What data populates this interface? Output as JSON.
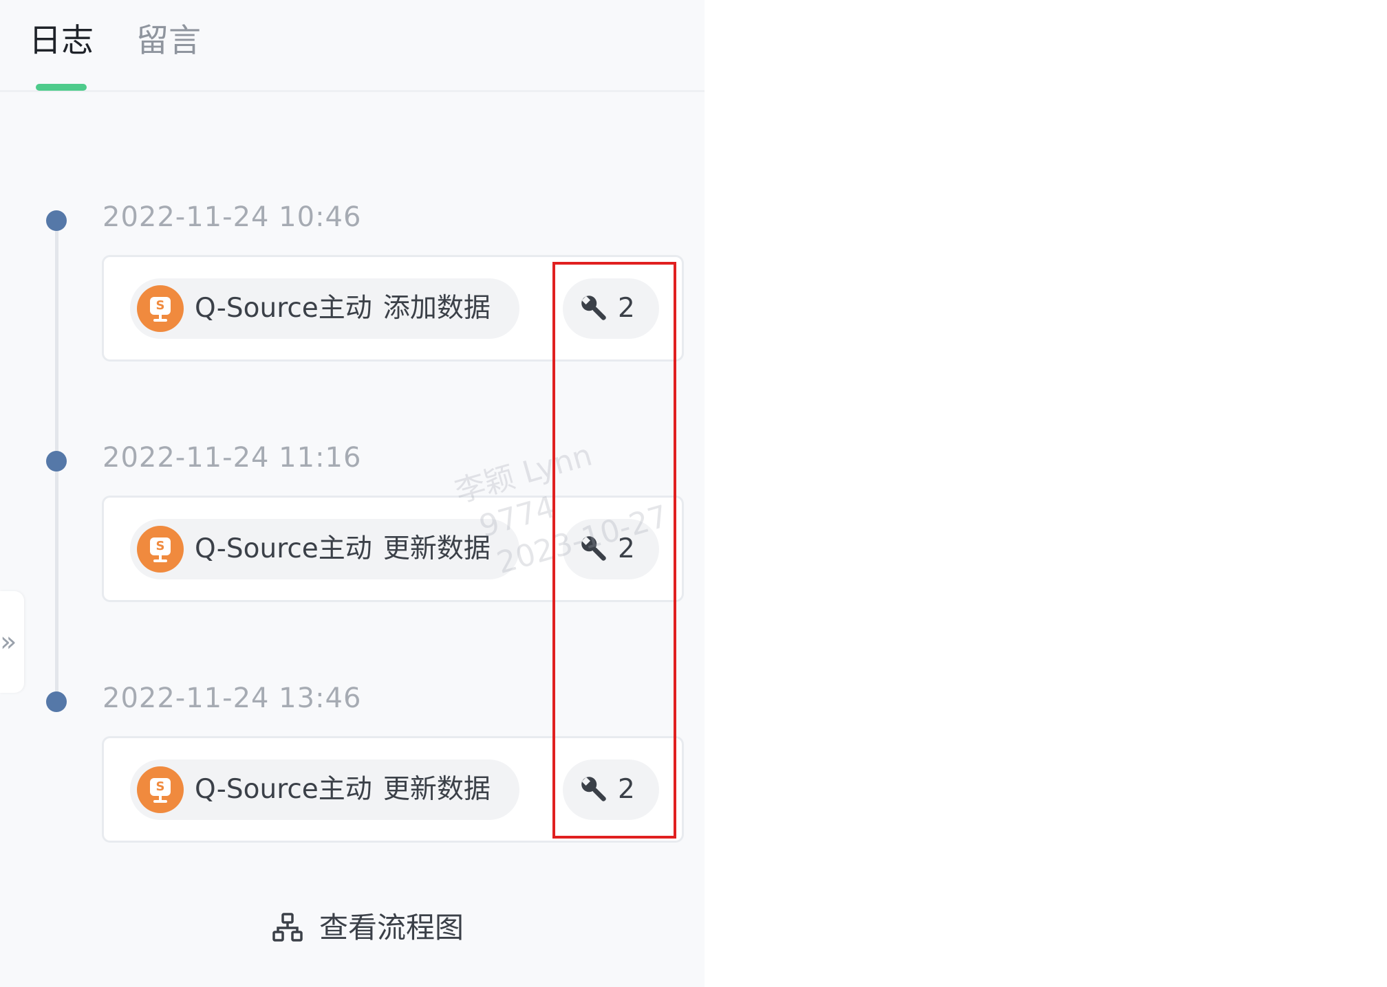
{
  "tabs": [
    {
      "label": "日志",
      "active": true
    },
    {
      "label": "留言",
      "active": false
    }
  ],
  "accent_color": "#4ecb8b",
  "highlight_color": "#e02020",
  "log_entries": [
    {
      "timestamp": "2022-11-24 10:46",
      "source": "Q-Source主动",
      "action": "添加数据",
      "icon": "source-s-icon",
      "count": "2"
    },
    {
      "timestamp": "2022-11-24 11:16",
      "source": "Q-Source主动",
      "action": "更新数据",
      "icon": "source-s-icon",
      "count": "2"
    },
    {
      "timestamp": "2022-11-24 13:46",
      "source": "Q-Source主动",
      "action": "更新数据",
      "icon": "source-s-icon",
      "count": "2"
    }
  ],
  "icon_letter": "S",
  "count_icon": "wrench-icon",
  "expand_icon": "»",
  "flow_link": {
    "label": "查看流程图",
    "icon": "flowchart-icon"
  },
  "watermark": {
    "name": "李颖 Lynn",
    "id": "9774",
    "date": "2023-10-27"
  }
}
